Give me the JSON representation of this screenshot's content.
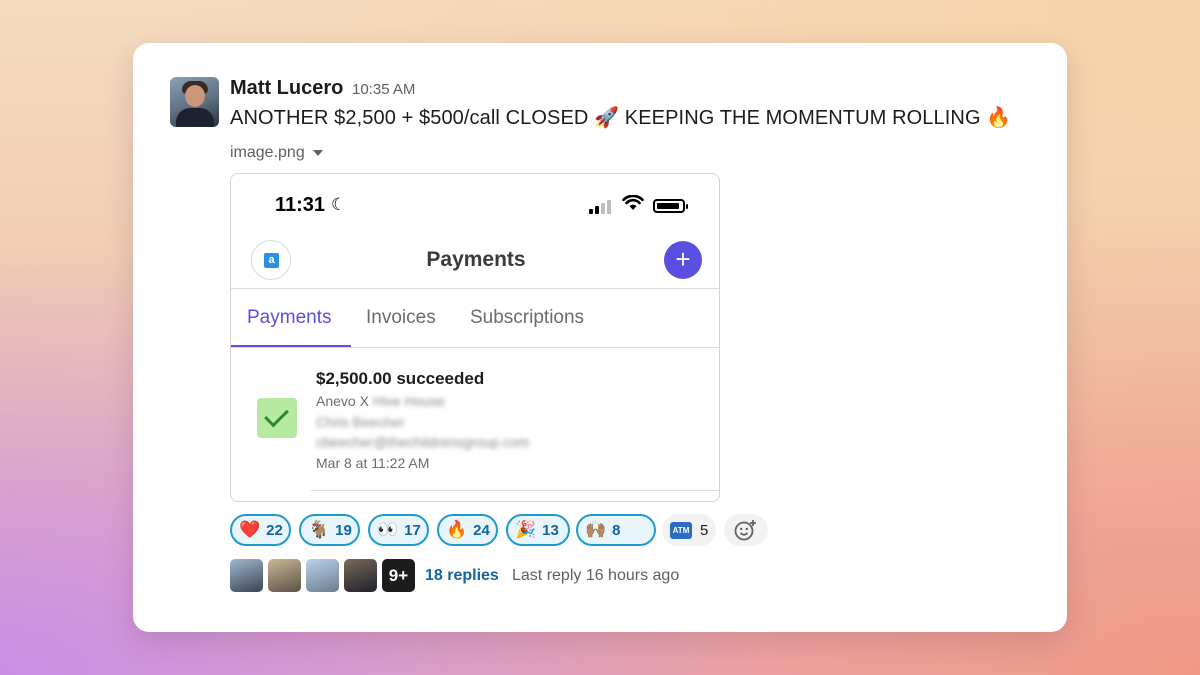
{
  "message": {
    "author": "Matt Lucero",
    "time": "10:35 AM",
    "text_part1": "ANOTHER $2,500 + $500/call CLOSED ",
    "emoji1": "🚀",
    "text_part2": "  KEEPING THE MOMENTUM ROLLING ",
    "emoji2": "🔥",
    "attachment_name": "image.png"
  },
  "phone": {
    "status_time": "11:31",
    "moon": "☾",
    "title": "Payments",
    "account_badge": "a",
    "plus": "+",
    "tabs": [
      "Payments",
      "Invoices",
      "Subscriptions"
    ],
    "active_tab": "Payments",
    "payment": {
      "amount": "$2,500.00 succeeded",
      "merchant_prefix": "Anevo X",
      "merchant_blurred": "Hive House",
      "customer_blurred": "Chris Beecher",
      "email_blurred": "cbeecher@thechildrensgroup.com",
      "date": "Mar 8 at 11:22 AM"
    }
  },
  "reactions": [
    {
      "emoji": "❤️",
      "icon": "heart-icon",
      "count": "22",
      "active": true
    },
    {
      "emoji": "🐐",
      "icon": "goat-icon",
      "count": "19",
      "active": true
    },
    {
      "emoji": "👀",
      "icon": "eyes-icon",
      "count": "17",
      "active": true
    },
    {
      "emoji": "🔥",
      "icon": "fire-icon",
      "count": "24",
      "active": true
    },
    {
      "emoji": "🎉",
      "icon": "party-popper-icon",
      "count": "13",
      "active": true
    },
    {
      "emoji": "🙌🏽",
      "icon": "raised-hands-icon",
      "count": "8",
      "active": true
    },
    {
      "emoji": "ATM",
      "icon": "atm-icon",
      "count": "5",
      "active": false
    }
  ],
  "thread": {
    "more_avatars": "9+",
    "replies": "18 replies",
    "last_reply": "Last reply 16 hours ago"
  },
  "colors": {
    "accent": "#5a4fe0",
    "link": "#1264a3",
    "reaction_border": "#1d9bd1",
    "success": "#b7eaa1"
  }
}
